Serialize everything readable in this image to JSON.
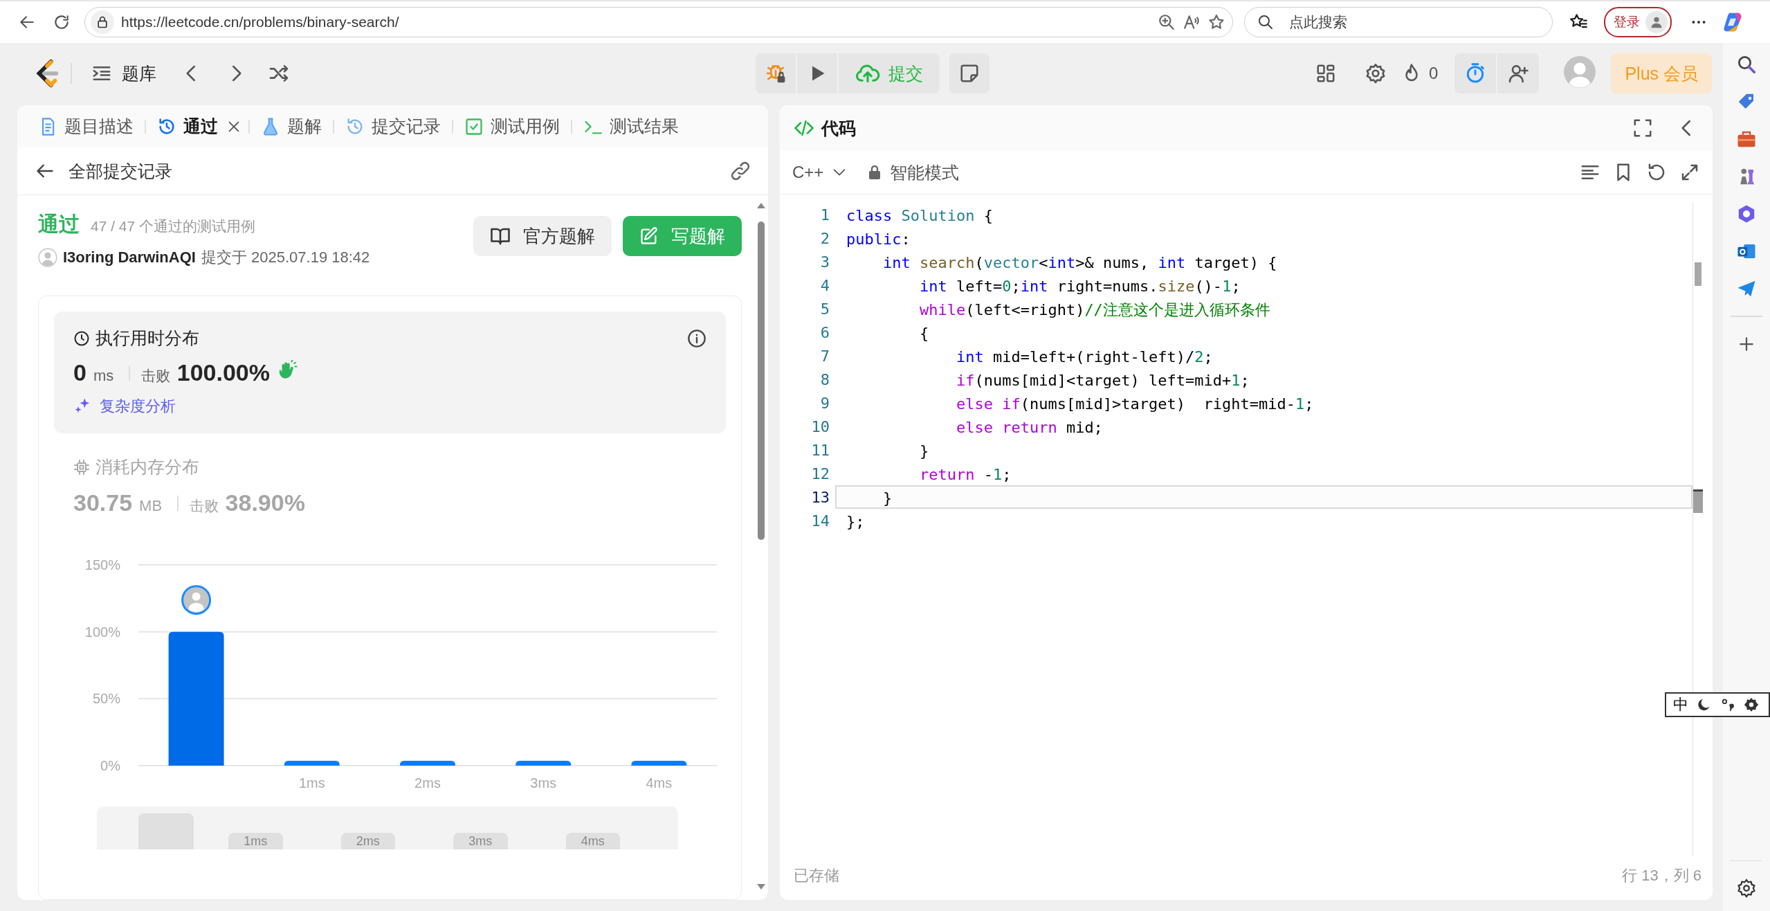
{
  "browser": {
    "url": "https://leetcode.cn/problems/binary-search/",
    "search_placeholder": "点此搜索",
    "login": "登录"
  },
  "nav": {
    "problem_bank": "题库",
    "submit": "提交",
    "streak": "0",
    "plus": "Plus 会员"
  },
  "left_panel": {
    "tabs": [
      {
        "kind": "description",
        "label": "题目描述",
        "selected": false,
        "closable": false
      },
      {
        "kind": "accepted",
        "label": "通过",
        "selected": true,
        "closable": true
      },
      {
        "kind": "solutions",
        "label": "题解",
        "selected": false,
        "closable": false
      },
      {
        "kind": "submissions",
        "label": "提交记录",
        "selected": false,
        "closable": false
      },
      {
        "kind": "testcase",
        "label": "测试用例",
        "selected": false,
        "closable": false
      },
      {
        "kind": "result",
        "label": "测试结果",
        "selected": false,
        "closable": false
      }
    ],
    "back_label": "全部提交记录",
    "status": "通过",
    "test_summary": "47 / 47 个通过的测试用例",
    "user": "I3oring DarwinAQI",
    "submitted_at": "提交于 2025.07.19 18:42",
    "buttons": [
      {
        "kind": "secondary",
        "label": "官方题解"
      },
      {
        "kind": "primary",
        "label": "写题解"
      }
    ],
    "runtime": {
      "title": "执行用时分布",
      "value": "0",
      "unit": "ms",
      "beats_label": "击败",
      "beats": "100.00%",
      "analysis_link": "复杂度分析"
    },
    "memory": {
      "title": "消耗内存分布",
      "value": "30.75",
      "unit": "MB",
      "beats_label": "击败",
      "beats": "38.90%"
    },
    "chart_data": {
      "type": "bar",
      "categories": [
        null,
        "1ms",
        "2ms",
        "3ms",
        "4ms"
      ],
      "values": [
        100,
        3,
        3,
        3,
        3
      ],
      "ylim": [
        0,
        150
      ],
      "yticks": [
        {
          "value": 0,
          "label": "0%"
        },
        {
          "value": 50,
          "label": "50%"
        },
        {
          "value": 100,
          "label": "100%"
        },
        {
          "value": 150,
          "label": "150%"
        }
      ]
    },
    "overview_labels": [
      "1ms",
      "2ms",
      "3ms",
      "4ms"
    ]
  },
  "code_panel": {
    "title": "代码",
    "language": "C++",
    "mode": "智能模式",
    "lines": [
      {
        "number": "1",
        "current": false,
        "tokens": [
          {
            "kind": "keyword",
            "text": "class"
          },
          {
            "kind": "type",
            "text": " Solution"
          },
          {
            "kind": "plain",
            "text": " {"
          }
        ]
      },
      {
        "number": "2",
        "current": false,
        "tokens": [
          {
            "kind": "keyword",
            "text": "public"
          },
          {
            "kind": "plain",
            "text": ":"
          }
        ]
      },
      {
        "number": "3",
        "current": false,
        "tokens": [
          {
            "kind": "keyword",
            "text": "    int"
          },
          {
            "kind": "function",
            "text": " search"
          },
          {
            "kind": "plain",
            "text": "("
          },
          {
            "kind": "type",
            "text": "vector"
          },
          {
            "kind": "plain",
            "text": "<"
          },
          {
            "kind": "keyword",
            "text": "int"
          },
          {
            "kind": "plain",
            "text": ">& nums, "
          },
          {
            "kind": "keyword",
            "text": "int"
          },
          {
            "kind": "plain",
            "text": " target) {"
          }
        ]
      },
      {
        "number": "4",
        "current": false,
        "tokens": [
          {
            "kind": "keyword",
            "text": "        int"
          },
          {
            "kind": "plain",
            "text": " left="
          },
          {
            "kind": "number",
            "text": "0"
          },
          {
            "kind": "plain",
            "text": ";"
          },
          {
            "kind": "keyword",
            "text": "int"
          },
          {
            "kind": "plain",
            "text": " right=nums."
          },
          {
            "kind": "function",
            "text": "size"
          },
          {
            "kind": "plain",
            "text": "()-"
          },
          {
            "kind": "number",
            "text": "1"
          },
          {
            "kind": "plain",
            "text": ";"
          }
        ]
      },
      {
        "number": "5",
        "current": false,
        "tokens": [
          {
            "kind": "control",
            "text": "        while"
          },
          {
            "kind": "plain",
            "text": "(left<=right)"
          },
          {
            "kind": "comment",
            "text": "//注意这个是进入循环条件"
          }
        ]
      },
      {
        "number": "6",
        "current": false,
        "tokens": [
          {
            "kind": "plain",
            "text": "        {"
          }
        ]
      },
      {
        "number": "7",
        "current": false,
        "tokens": [
          {
            "kind": "keyword",
            "text": "            int"
          },
          {
            "kind": "plain",
            "text": " mid=left+(right-left)/"
          },
          {
            "kind": "number",
            "text": "2"
          },
          {
            "kind": "plain",
            "text": ";"
          }
        ]
      },
      {
        "number": "8",
        "current": false,
        "tokens": [
          {
            "kind": "control",
            "text": "            if"
          },
          {
            "kind": "plain",
            "text": "(nums[mid]<target) left=mid+"
          },
          {
            "kind": "number",
            "text": "1"
          },
          {
            "kind": "plain",
            "text": ";"
          }
        ]
      },
      {
        "number": "9",
        "current": false,
        "tokens": [
          {
            "kind": "control",
            "text": "            else if"
          },
          {
            "kind": "plain",
            "text": "(nums[mid]>target)  right=mid-"
          },
          {
            "kind": "number",
            "text": "1"
          },
          {
            "kind": "plain",
            "text": ";"
          }
        ]
      },
      {
        "number": "10",
        "current": false,
        "tokens": [
          {
            "kind": "control",
            "text": "            else return"
          },
          {
            "kind": "plain",
            "text": " mid;"
          }
        ]
      },
      {
        "number": "11",
        "current": false,
        "tokens": [
          {
            "kind": "plain",
            "text": "        }"
          }
        ]
      },
      {
        "number": "12",
        "current": false,
        "tokens": [
          {
            "kind": "control",
            "text": "        return"
          },
          {
            "kind": "plain",
            "text": " -"
          },
          {
            "kind": "number",
            "text": "1"
          },
          {
            "kind": "plain",
            "text": ";"
          }
        ]
      },
      {
        "number": "13",
        "current": true,
        "tokens": [
          {
            "kind": "plain",
            "text": "    }"
          }
        ]
      },
      {
        "number": "14",
        "current": false,
        "tokens": [
          {
            "kind": "plain",
            "text": "};"
          }
        ]
      }
    ],
    "status": "已存储",
    "cursor": "行 13，列 6"
  },
  "ime": {
    "language": "中"
  }
}
